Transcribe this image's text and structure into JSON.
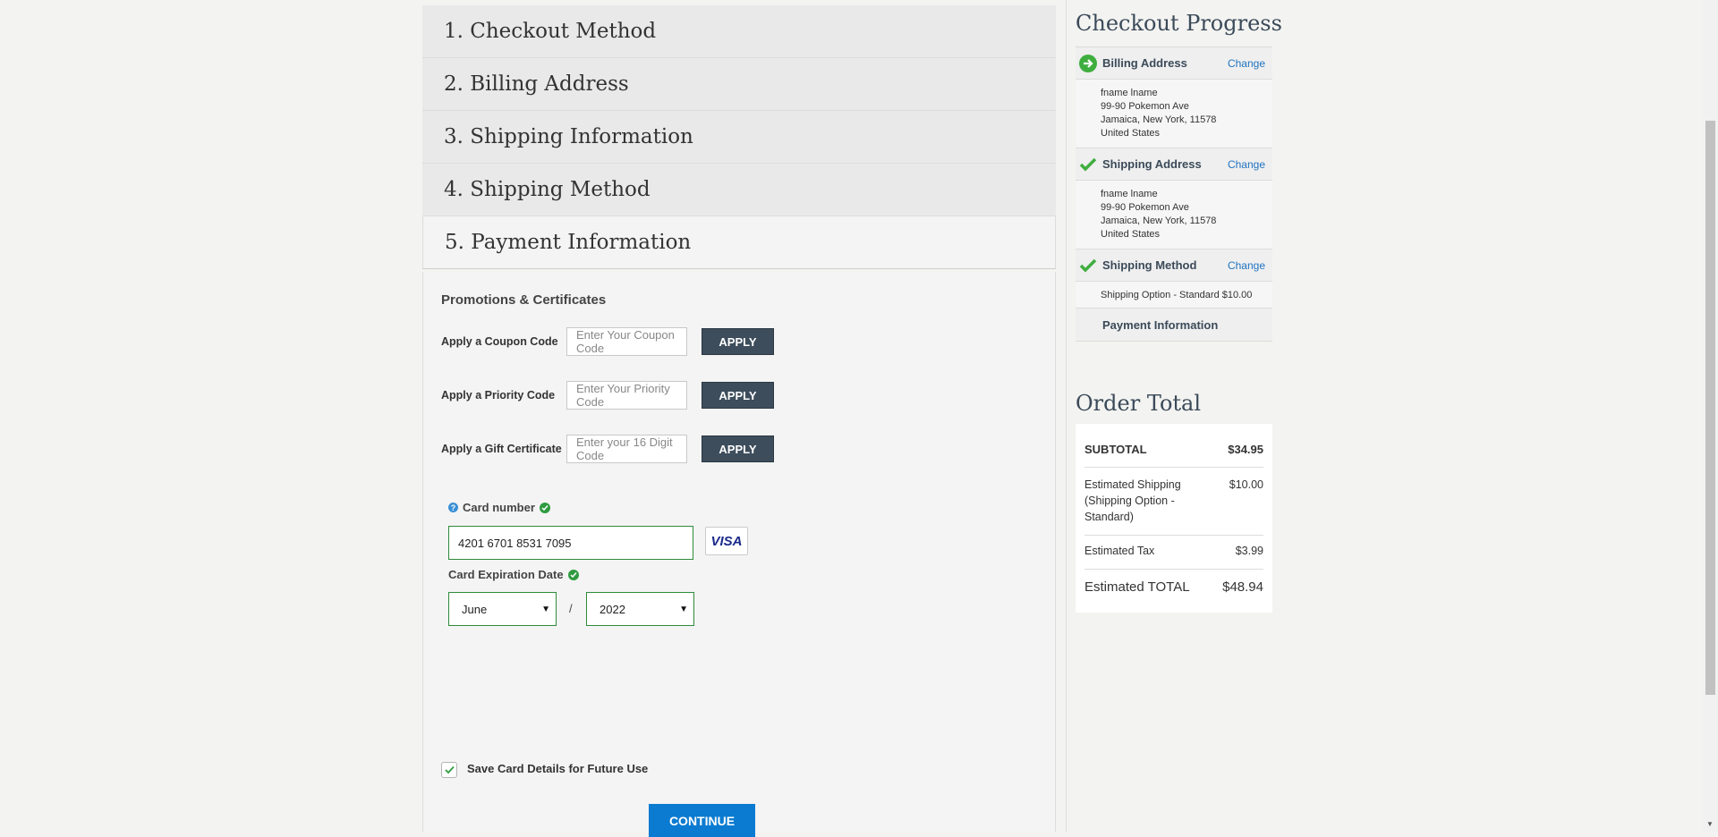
{
  "steps": [
    {
      "label": "1. Checkout Method"
    },
    {
      "label": "2. Billing Address"
    },
    {
      "label": "3. Shipping Information"
    },
    {
      "label": "4. Shipping Method"
    },
    {
      "label": "5. Payment Information"
    }
  ],
  "payment": {
    "promo_title": "Promotions & Certificates",
    "coupon": {
      "label": "Apply a Coupon Code",
      "placeholder": "Enter Your Coupon Code",
      "button": "APPLY"
    },
    "priority": {
      "label": "Apply a Priority Code",
      "placeholder": "Enter Your Priority Code",
      "button": "APPLY"
    },
    "gift": {
      "label": "Apply a Gift Certificate",
      "placeholder": "Enter your 16 Digit Code",
      "button": "APPLY"
    },
    "card_number_label": "Card number",
    "card_number_value": "4201 6701 8531 7095",
    "card_brand": "VISA",
    "expiry_label": "Card Expiration Date",
    "expiry_month": "June",
    "expiry_separator": "/",
    "expiry_year": "2022",
    "save_label": "Save Card Details for Future Use",
    "save_checked": true,
    "continue_label": "CONTINUE"
  },
  "progress": {
    "title": "Checkout Progress",
    "billing": {
      "label": "Billing Address",
      "change": "Change",
      "name": "fname lname",
      "street": "99-90 Pokemon Ave",
      "city": "Jamaica, New York, 11578",
      "country": "United States"
    },
    "shipping_address": {
      "label": "Shipping Address",
      "change": "Change",
      "name": "fname lname",
      "street": "99-90 Pokemon Ave",
      "city": "Jamaica, New York, 11578",
      "country": "United States"
    },
    "shipping_method": {
      "label": "Shipping Method",
      "change": "Change",
      "detail": "Shipping Option - Standard $10.00"
    },
    "payment_label": "Payment Information"
  },
  "order_total": {
    "title": "Order Total",
    "subtotal_label": "SUBTOTAL",
    "subtotal": "$34.95",
    "shipping_label_1": "Estimated Shipping",
    "shipping_label_2": "(Shipping Option -",
    "shipping_label_3": "Standard)",
    "shipping": "$10.00",
    "tax_label": "Estimated Tax",
    "tax": "$3.99",
    "total_label": "Estimated TOTAL",
    "total": "$48.94"
  },
  "colors": {
    "accent_button": "#0a7bd1",
    "apply_button": "#3d4d5b",
    "success": "#2e9b3f",
    "link": "#1f73c1"
  }
}
